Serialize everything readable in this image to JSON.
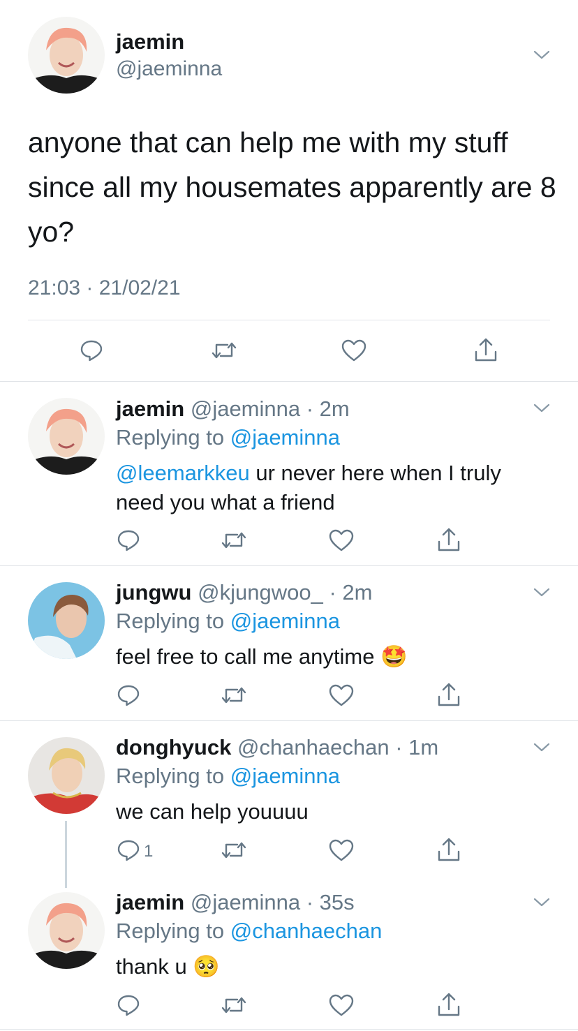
{
  "main_tweet": {
    "name": "jaemin",
    "handle": "@jaeminna",
    "text": "anyone that can help me with my stuff since all my housemates apparently are 8 yo?",
    "timestamp": "21:03 · 21/02/21"
  },
  "replies": [
    {
      "name": "jaemin",
      "handle": "@jaeminna",
      "time": "· 2m",
      "replying_prefix": "Replying to",
      "replying_to": "@jaeminna",
      "mention": "@leemarkkeu",
      "text": " ur never here when I truly need you what a friend",
      "reply_count": ""
    },
    {
      "name": "jungwu",
      "handle": "@kjungwoo_",
      "time": "· 2m",
      "replying_prefix": "Replying to",
      "replying_to": "@jaeminna",
      "text": "feel free to call me anytime",
      "emoji": "🤩",
      "reply_count": ""
    },
    {
      "name": "donghyuck",
      "handle": "@chanhaechan",
      "time": "· 1m",
      "replying_prefix": "Replying to",
      "replying_to": "@jaeminna",
      "text": "we can help youuuu",
      "reply_count": "1"
    },
    {
      "name": "jaemin",
      "handle": "@jaeminna",
      "time": "· 35s",
      "replying_prefix": "Replying to",
      "replying_to": "@chanhaechan",
      "text": "thank u",
      "emoji": "🥺",
      "reply_count": ""
    }
  ],
  "icons": [
    "chevron-down-icon",
    "reply-icon",
    "retweet-icon",
    "like-icon",
    "share-icon"
  ],
  "colors": {
    "link": "#1b95e0",
    "secondary": "#657786",
    "divider": "#e1e4e8"
  }
}
